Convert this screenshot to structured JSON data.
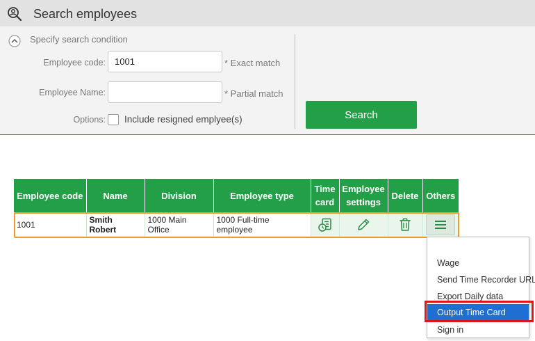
{
  "header": {
    "title": "Search employees"
  },
  "search": {
    "condition_label": "Specify search condition",
    "employee_code_label": "Employee code:",
    "employee_code_value": "1001",
    "employee_code_hint": "* Exact match",
    "employee_name_label": "Employee Name:",
    "employee_name_value": "",
    "employee_name_hint": "* Partial match",
    "options_label": "Options:",
    "include_resigned_label": "Include resigned emplyee(s)",
    "include_resigned_checked": false,
    "search_button": "Search"
  },
  "table": {
    "columns": {
      "code": "Employee code",
      "name": "Name",
      "division": "Division",
      "type": "Employee type",
      "time_card_1": "Time",
      "time_card_2": "card",
      "settings_1": "Employee",
      "settings_2": "settings",
      "delete": "Delete",
      "others": "Others"
    },
    "rows": [
      {
        "code": "1001",
        "name": "Smith Robert",
        "division": "1000 Main Office",
        "type": "1000 Full-time employee"
      }
    ]
  },
  "others_menu": {
    "items": [
      "Wage",
      "Send Time Recorder URL",
      "Export Daily data",
      "Output Time Card",
      "Sign in"
    ],
    "selected_index": 3
  },
  "colors": {
    "accent_green": "#23a047",
    "row_outline": "#ef9a2a",
    "menu_selected": "#1f6ed4",
    "highlight_red": "#e0161d"
  },
  "icons": [
    "magnifier-person-icon",
    "chevron-up-icon",
    "time-card-icon",
    "pencil-icon",
    "trash-icon",
    "hamburger-icon"
  ]
}
